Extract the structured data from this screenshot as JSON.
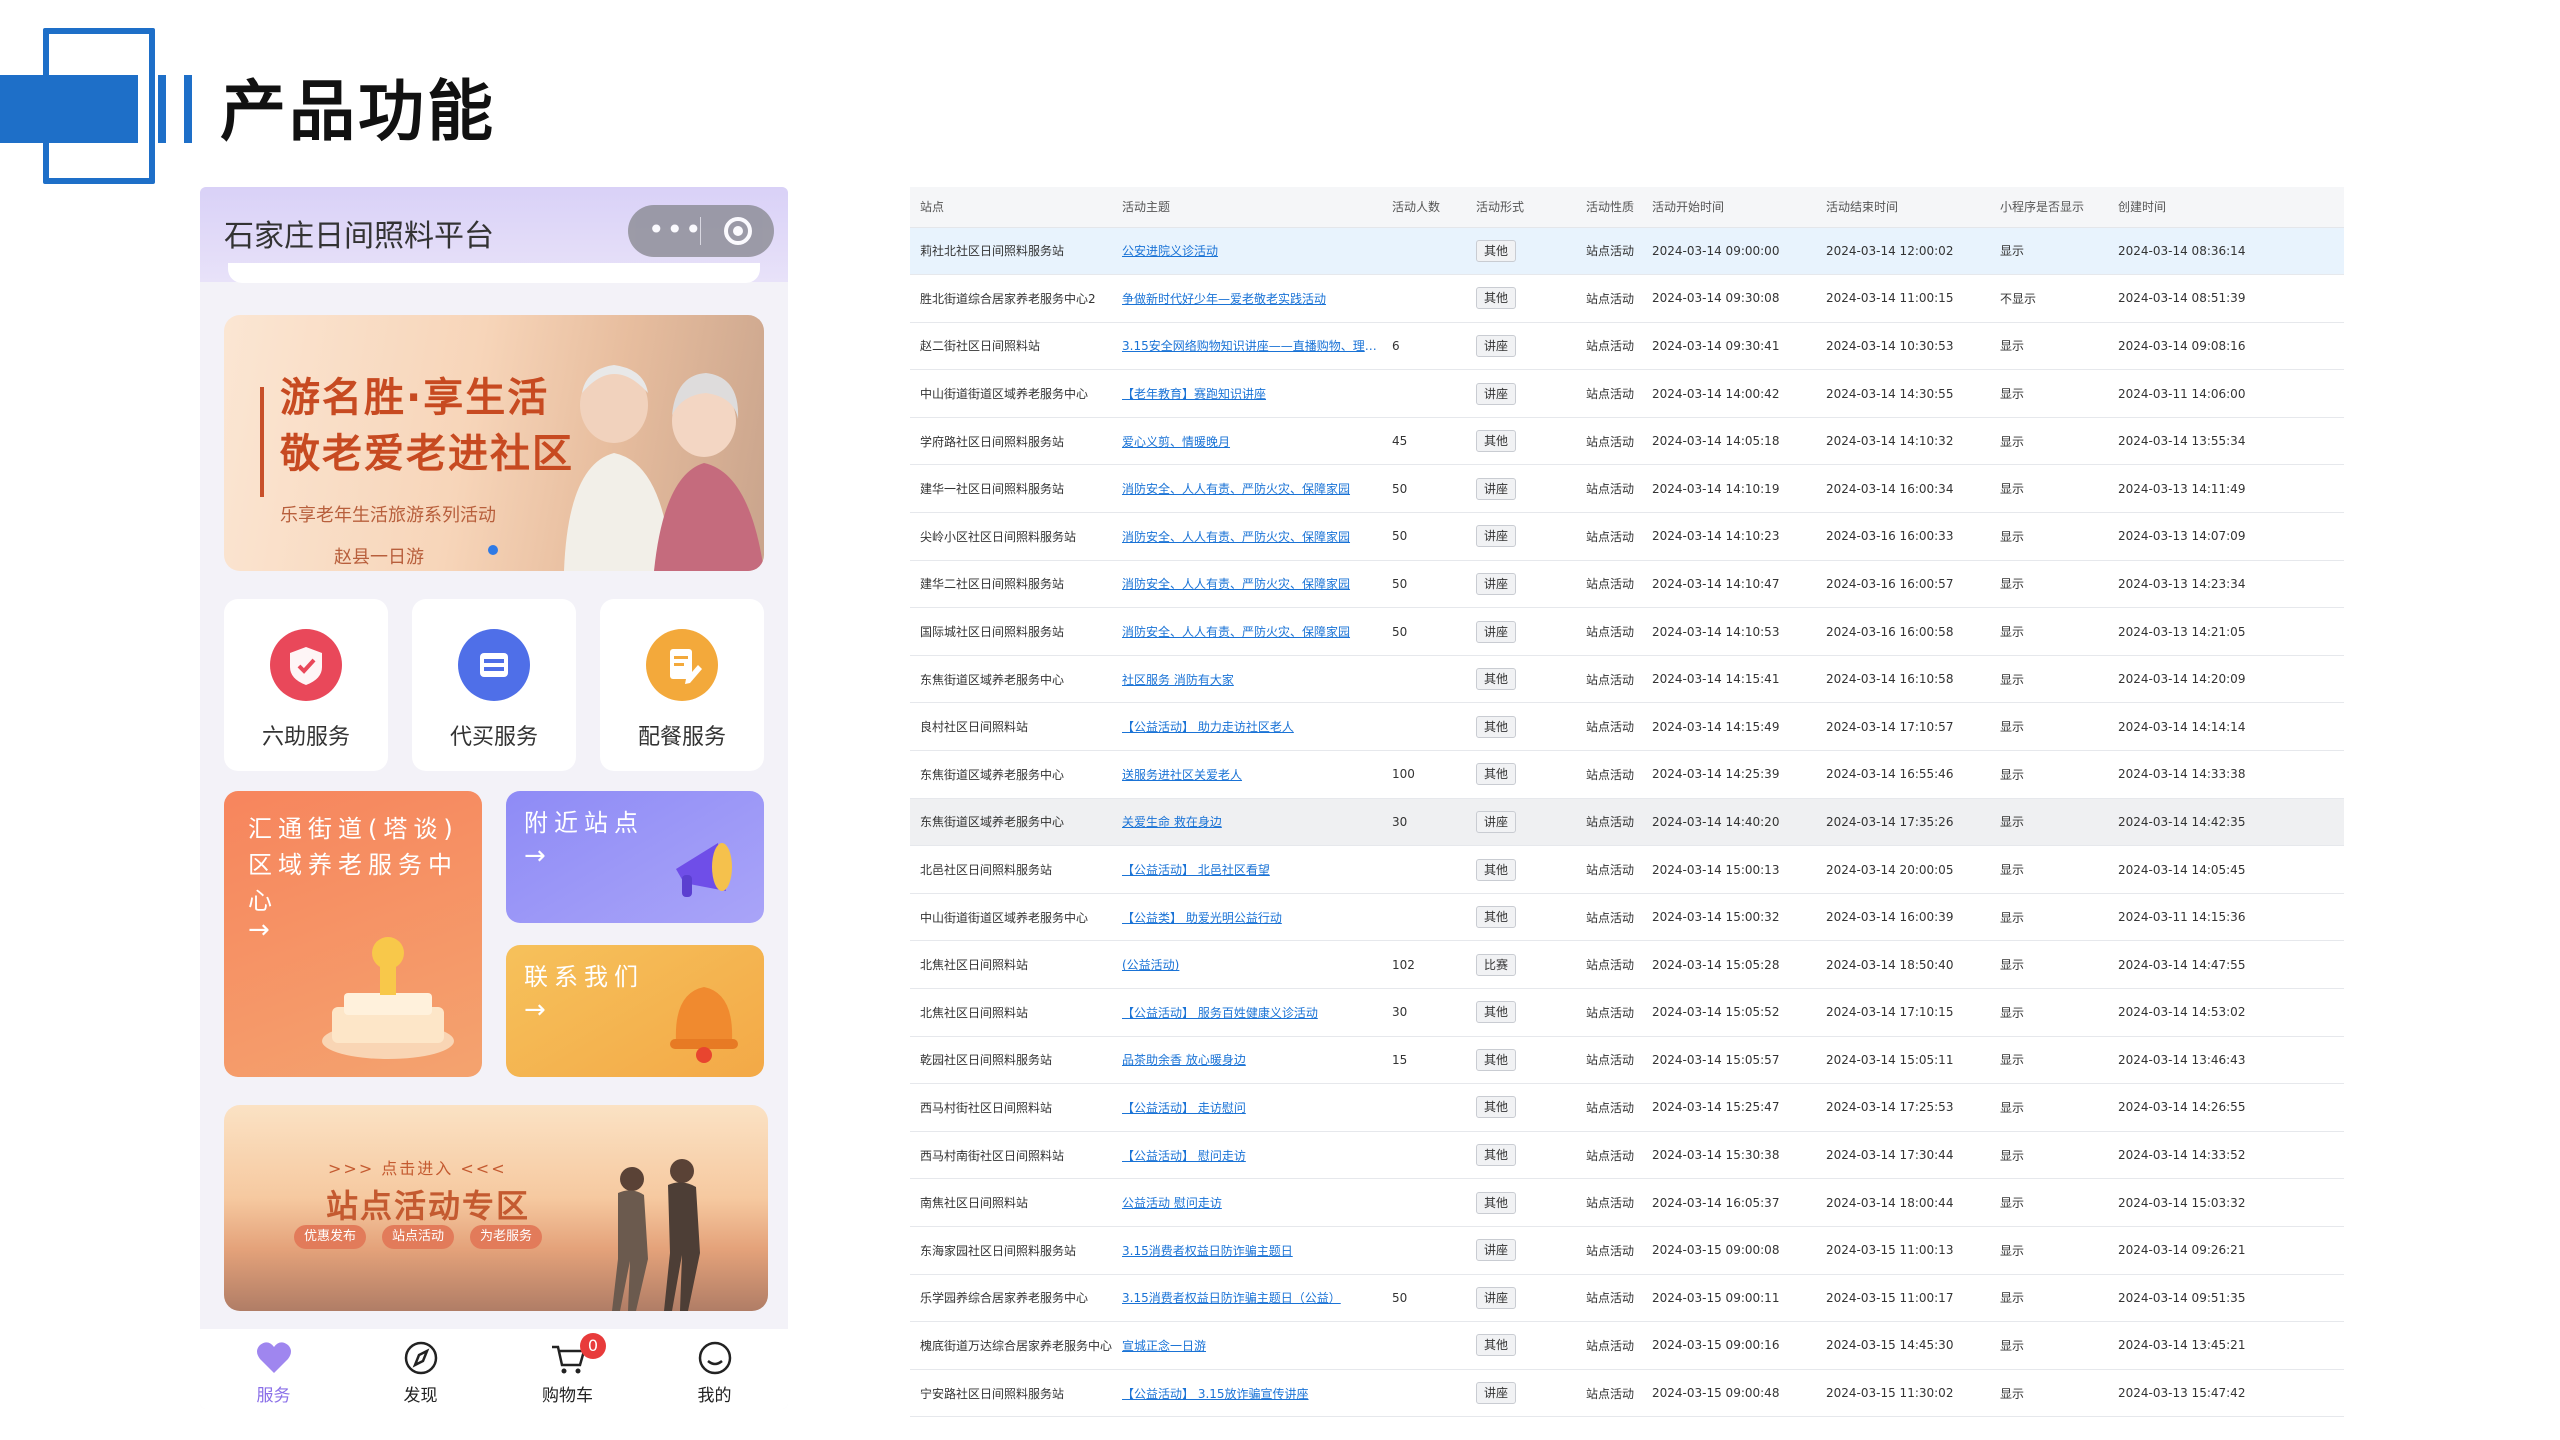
{
  "slide": {
    "title": "产品功能"
  },
  "phone": {
    "app_title": "石家庄日间照料平台",
    "capsule_dots": "•••",
    "banner": {
      "line1": "游名胜·享生活",
      "line2": "敬老爱老进社区",
      "subtitle": "乐享老年生活旅游系列活动",
      "sub2": "赵县一日游"
    },
    "services": [
      {
        "label": "六助服务",
        "color": "#e9485a"
      },
      {
        "label": "代买服务",
        "color": "#4f6fe8"
      },
      {
        "label": "配餐服务",
        "color": "#f3a93b"
      }
    ],
    "tiles": {
      "center": {
        "text": "汇通街道(塔谈)区域养老服务中心",
        "arrow": "→"
      },
      "nearby": {
        "text": "附近站点",
        "arrow": "→"
      },
      "contact": {
        "text": "联系我们",
        "arrow": "→"
      }
    },
    "promo": {
      "small": ">>> 点击进入 <<<",
      "big": "站点活动专区",
      "chips": [
        "优惠发布",
        "站点活动",
        "为老服务"
      ]
    },
    "tabs": [
      {
        "label": "服务",
        "active": true
      },
      {
        "label": "发现",
        "active": false
      },
      {
        "label": "购物车",
        "active": false,
        "badge": "0"
      },
      {
        "label": "我的",
        "active": false
      }
    ]
  },
  "table": {
    "headers": [
      "站点",
      "活动主题",
      "活动人数",
      "活动形式",
      "活动性质",
      "活动开始时间",
      "活动结束时间",
      "小程序是否显示",
      "创建时间"
    ],
    "rows": [
      {
        "site": "莉社北社区日间照料服务站",
        "theme": "公安进院义诊活动",
        "count": "",
        "form": "其他",
        "nature": "站点活动",
        "start": "2024-03-14 09:00:00",
        "end": "2024-03-14 12:00:02",
        "show": "显示",
        "created": "2024-03-14 08:36:14"
      },
      {
        "site": "胜北街道综合居家养老服务中心2",
        "theme": "争做新时代好少年—爱老敬老实践活动",
        "count": "",
        "form": "其他",
        "nature": "站点活动",
        "start": "2024-03-14 09:30:08",
        "end": "2024-03-14 11:00:15",
        "show": "不显示",
        "created": "2024-03-14 08:51:39"
      },
      {
        "site": "赵二街社区日间照料站",
        "theme": "3.15安全网络购物知识讲座——直播购物、理性消费、...",
        "count": "6",
        "form": "讲座",
        "nature": "站点活动",
        "start": "2024-03-14 09:30:41",
        "end": "2024-03-14 10:30:53",
        "show": "显示",
        "created": "2024-03-14 09:08:16"
      },
      {
        "site": "中山街道街道区域养老服务中心",
        "theme": "【老年教育】赛跑知识讲座",
        "count": "",
        "form": "讲座",
        "nature": "站点活动",
        "start": "2024-03-14 14:00:42",
        "end": "2024-03-14 14:30:55",
        "show": "显示",
        "created": "2024-03-11 14:06:00"
      },
      {
        "site": "学府路社区日间照料服务站",
        "theme": "爱心义剪、情暖晚月",
        "count": "45",
        "form": "其他",
        "nature": "站点活动",
        "start": "2024-03-14 14:05:18",
        "end": "2024-03-14 14:10:32",
        "show": "显示",
        "created": "2024-03-14 13:55:34"
      },
      {
        "site": "建华一社区日间照料服务站",
        "theme": "消防安全、人人有责、严防火灾、保障家园",
        "count": "50",
        "form": "讲座",
        "nature": "站点活动",
        "start": "2024-03-14 14:10:19",
        "end": "2024-03-14 16:00:34",
        "show": "显示",
        "created": "2024-03-13 14:11:49"
      },
      {
        "site": "尖岭小区社区日间照料服务站",
        "theme": "消防安全、人人有责、严防火灾、保障家园",
        "count": "50",
        "form": "讲座",
        "nature": "站点活动",
        "start": "2024-03-14 14:10:23",
        "end": "2024-03-16 16:00:33",
        "show": "显示",
        "created": "2024-03-13 14:07:09"
      },
      {
        "site": "建华二社区日间照料服务站",
        "theme": "消防安全、人人有责、严防火灾、保障家园",
        "count": "50",
        "form": "讲座",
        "nature": "站点活动",
        "start": "2024-03-14 14:10:47",
        "end": "2024-03-16 16:00:57",
        "show": "显示",
        "created": "2024-03-13 14:23:34"
      },
      {
        "site": "国际城社区日间照料服务站",
        "theme": "消防安全、人人有责、严防火灾、保障家园",
        "count": "50",
        "form": "讲座",
        "nature": "站点活动",
        "start": "2024-03-14 14:10:53",
        "end": "2024-03-16 16:00:58",
        "show": "显示",
        "created": "2024-03-13 14:21:05"
      },
      {
        "site": "东焦街道区域养老服务中心",
        "theme": "社区服务 消防有大家",
        "count": "",
        "form": "其他",
        "nature": "站点活动",
        "start": "2024-03-14 14:15:41",
        "end": "2024-03-14 16:10:58",
        "show": "显示",
        "created": "2024-03-14 14:20:09"
      },
      {
        "site": "良村社区日间照料站",
        "theme": "【公益活动】 助力走访社区老人",
        "count": "",
        "form": "其他",
        "nature": "站点活动",
        "start": "2024-03-14 14:15:49",
        "end": "2024-03-14 17:10:57",
        "show": "显示",
        "created": "2024-03-14 14:14:14"
      },
      {
        "site": "东焦街道区域养老服务中心",
        "theme": "送服务进社区关爱老人",
        "count": "100",
        "form": "其他",
        "nature": "站点活动",
        "start": "2024-03-14 14:25:39",
        "end": "2024-03-14 16:55:46",
        "show": "显示",
        "created": "2024-03-14 14:33:38"
      },
      {
        "site": "东焦街道区域养老服务中心",
        "theme": "关爱生命 救在身边",
        "count": "30",
        "form": "讲座",
        "nature": "站点活动",
        "start": "2024-03-14 14:40:20",
        "end": "2024-03-14 17:35:26",
        "show": "显示",
        "created": "2024-03-14 14:42:35"
      },
      {
        "site": "北邑社区日间照料服务站",
        "theme": "【公益活动】 北邑社区看望",
        "count": "",
        "form": "其他",
        "nature": "站点活动",
        "start": "2024-03-14 15:00:13",
        "end": "2024-03-14 20:00:05",
        "show": "显示",
        "created": "2024-03-14 14:05:45"
      },
      {
        "site": "中山街道街道区域养老服务中心",
        "theme": "【公益类】 助爱光明公益行动",
        "count": "",
        "form": "其他",
        "nature": "站点活动",
        "start": "2024-03-14 15:00:32",
        "end": "2024-03-14 16:00:39",
        "show": "显示",
        "created": "2024-03-11 14:15:36"
      },
      {
        "site": "北焦社区日间照料站",
        "theme": "(公益活动)",
        "count": "102",
        "form": "比赛",
        "nature": "站点活动",
        "start": "2024-03-14 15:05:28",
        "end": "2024-03-14 18:50:40",
        "show": "显示",
        "created": "2024-03-14 14:47:55"
      },
      {
        "site": "北焦社区日间照料站",
        "theme": "【公益活动】 服务百姓健康义诊活动",
        "count": "30",
        "form": "其他",
        "nature": "站点活动",
        "start": "2024-03-14 15:05:52",
        "end": "2024-03-14 17:10:15",
        "show": "显示",
        "created": "2024-03-14 14:53:02"
      },
      {
        "site": "乾园社区日间照料服务站",
        "theme": "品茶助余香 放心暖身边",
        "count": "15",
        "form": "其他",
        "nature": "站点活动",
        "start": "2024-03-14 15:05:57",
        "end": "2024-03-14 15:05:11",
        "show": "显示",
        "created": "2024-03-14 13:46:43"
      },
      {
        "site": "西马村街社区日间照料站",
        "theme": "【公益活动】 走访慰问",
        "count": "",
        "form": "其他",
        "nature": "站点活动",
        "start": "2024-03-14 15:25:47",
        "end": "2024-03-14 17:25:53",
        "show": "显示",
        "created": "2024-03-14 14:26:55"
      },
      {
        "site": "西马村南街社区日间照料站",
        "theme": "【公益活动】 慰问走访",
        "count": "",
        "form": "其他",
        "nature": "站点活动",
        "start": "2024-03-14 15:30:38",
        "end": "2024-03-14 17:30:44",
        "show": "显示",
        "created": "2024-03-14 14:33:52"
      },
      {
        "site": "南焦社区日间照料站",
        "theme": "公益活动 慰问走访",
        "count": "",
        "form": "其他",
        "nature": "站点活动",
        "start": "2024-03-14 16:05:37",
        "end": "2024-03-14 18:00:44",
        "show": "显示",
        "created": "2024-03-14 15:03:32"
      },
      {
        "site": "东海家园社区日间照料服务站",
        "theme": "3.15消费者权益日防诈骗主题日",
        "count": "",
        "form": "讲座",
        "nature": "站点活动",
        "start": "2024-03-15 09:00:08",
        "end": "2024-03-15 11:00:13",
        "show": "显示",
        "created": "2024-03-14 09:26:21"
      },
      {
        "site": "乐学园养综合居家养老服务中心",
        "theme": "3.15消费者权益日防诈骗主题日（公益）",
        "count": "50",
        "form": "讲座",
        "nature": "站点活动",
        "start": "2024-03-15 09:00:11",
        "end": "2024-03-15 11:00:17",
        "show": "显示",
        "created": "2024-03-14 09:51:35"
      },
      {
        "site": "槐底街道万达综合居家养老服务中心",
        "theme": "宣城正念一日游",
        "count": "",
        "form": "其他",
        "nature": "站点活动",
        "start": "2024-03-15 09:00:16",
        "end": "2024-03-15 14:45:30",
        "show": "显示",
        "created": "2024-03-14 13:45:21"
      },
      {
        "site": "宁安路社区日间照料服务站",
        "theme": "【公益活动】 3.15放诈骗宣传讲座",
        "count": "",
        "form": "讲座",
        "nature": "站点活动",
        "start": "2024-03-15 09:00:48",
        "end": "2024-03-15 11:30:02",
        "show": "显示",
        "created": "2024-03-13 15:47:42"
      }
    ]
  }
}
